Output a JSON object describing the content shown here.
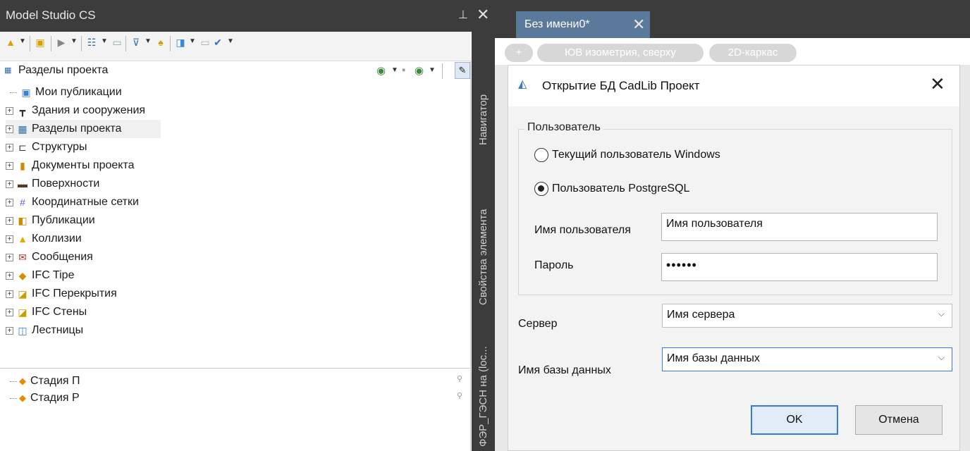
{
  "left_panel": {
    "title": "Model Studio CS",
    "pin_icon": "pin-icon",
    "close_glyph": "✕",
    "combo": {
      "label": "Разделы проекта"
    },
    "tree": [
      {
        "label": "Мои публикации",
        "icon": "publication-icon",
        "expand": false
      },
      {
        "label": "Здания и сооружения",
        "icon": "building-icon",
        "expand": true
      },
      {
        "label": "Разделы проекта",
        "icon": "sections-icon",
        "expand": true,
        "selected": true
      },
      {
        "label": "Структуры",
        "icon": "structure-icon",
        "expand": true
      },
      {
        "label": "Документы проекта",
        "icon": "documents-icon",
        "expand": true
      },
      {
        "label": "Поверхности",
        "icon": "surface-icon",
        "expand": true
      },
      {
        "label": "Координатные сетки",
        "icon": "grid-icon",
        "expand": true
      },
      {
        "label": "Публикации",
        "icon": "publications-icon",
        "expand": true
      },
      {
        "label": "Коллизии",
        "icon": "warning-icon",
        "expand": true
      },
      {
        "label": "Сообщения",
        "icon": "message-icon",
        "expand": true
      },
      {
        "label": "IFC Tipe",
        "icon": "ifc-type-icon",
        "expand": true
      },
      {
        "label": "IFC Перекрытия",
        "icon": "ifc-slab-icon",
        "expand": true
      },
      {
        "label": "IFC Стены",
        "icon": "ifc-wall-icon",
        "expand": true
      },
      {
        "label": "Лестницы",
        "icon": "stairs-icon",
        "expand": true
      }
    ],
    "stages": [
      {
        "label": "Стадия П"
      },
      {
        "label": "Стадия Р"
      }
    ],
    "vertical_tabs": {
      "navigator": "Навигатор",
      "properties": "Свойства элемента",
      "connection": "ФЭР_ГЭСН на (loc..."
    }
  },
  "editor": {
    "tab_title": "Без имени0*",
    "tab_close": "✕",
    "view_pills": {
      "plus": "+",
      "view": "ЮВ изометрия, сверху",
      "style": "2D-каркас"
    }
  },
  "dialog": {
    "title": "Открытие БД CadLib Проект",
    "close_glyph": "✕",
    "user_group": {
      "legend": "Пользователь",
      "option_windows": "Текущий пользователь Windows",
      "option_postgres": "Пользователь PostgreSQL",
      "selected": "postgres",
      "username_label": "Имя пользователя",
      "username_value": "Имя пользователя",
      "password_label": "Пароль",
      "password_value": "••••••"
    },
    "server_label": "Сервер",
    "server_value": "Имя сервера",
    "database_label": "Имя базы данных",
    "database_value": "Имя базы данных",
    "ok_label": "OK",
    "cancel_label": "Отмена"
  },
  "colors": {
    "dark_chrome": "#3c3c3c",
    "tab_active": "#5b7a9b",
    "focus_border": "#3b7bd6",
    "pill": "#d7d7d7"
  }
}
